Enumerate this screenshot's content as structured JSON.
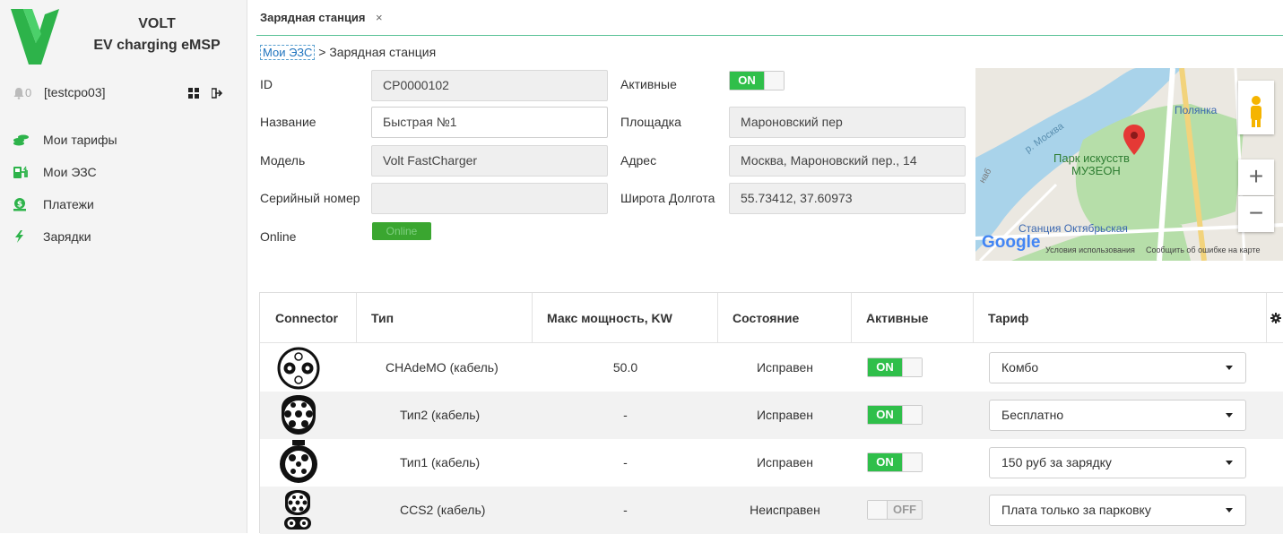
{
  "brand": {
    "name": "VOLT",
    "subtitle": "EV charging eMSP",
    "color": "#2db34a"
  },
  "user": {
    "notifications": "0",
    "username": "[testcpo03]"
  },
  "nav": [
    {
      "label": "Мои тарифы",
      "icon": "coins-icon"
    },
    {
      "label": "Мои ЭЗС",
      "icon": "charger-station-icon"
    },
    {
      "label": "Платежи",
      "icon": "payment-icon"
    },
    {
      "label": "Зарядки",
      "icon": "lightning-icon"
    }
  ],
  "tab": {
    "label": "Зарядная станция",
    "close": "×"
  },
  "breadcrumb": {
    "link": "Мои ЭЗС",
    "separator": ">",
    "current": "Зарядная станция"
  },
  "form": {
    "id_label": "ID",
    "id_value": "CP0000102",
    "name_label": "Название",
    "name_value": "Быстрая №1",
    "model_label": "Модель",
    "model_value": "Volt FastCharger",
    "serial_label": "Серийный номер",
    "serial_value": "",
    "online_label": "Online",
    "online_badge": "Online",
    "active_label": "Активные",
    "active_toggle": "ON",
    "site_label": "Площадка",
    "site_value": "Мароновский пер",
    "address_label": "Адрес",
    "address_value": "Москва, Мароновский пер., 14",
    "coords_label": "Широта Долгота",
    "coords_value": "55.73412, 37.60973"
  },
  "map": {
    "labels": {
      "park": "Парк искусств",
      "museum": "МУЗЕОН",
      "river": "р. Москва",
      "polyanka": "Полянка",
      "station": "Станция Октябрьская",
      "google": "Google",
      "terms": "Условия использования",
      "report": "Сообщить об ошибке на карте",
      "road": "наб"
    },
    "zoom_in": "+",
    "zoom_out": "−"
  },
  "table": {
    "headers": [
      "Connector",
      "Тип",
      "Макс мощность, KW",
      "Состояние",
      "Активные",
      "Тариф"
    ],
    "rows": [
      {
        "type": "CHAdeMO (кабель)",
        "power": "50.0",
        "state": "Исправен",
        "active": "ON",
        "tariff": "Комбо"
      },
      {
        "type": "Тип2 (кабель)",
        "power": "-",
        "state": "Исправен",
        "active": "ON",
        "tariff": "Бесплатно"
      },
      {
        "type": "Тип1 (кабель)",
        "power": "-",
        "state": "Исправен",
        "active": "ON",
        "tariff": "150 руб за зарядку"
      },
      {
        "type": "CCS2 (кабель)",
        "power": "-",
        "state": "Неисправен",
        "active": "OFF",
        "tariff": "Плата только за парковку"
      }
    ]
  }
}
